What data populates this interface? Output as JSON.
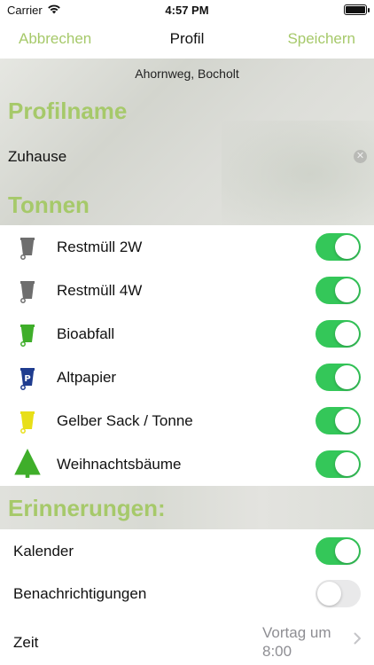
{
  "status": {
    "carrier": "Carrier",
    "time": "4:57 PM"
  },
  "nav": {
    "cancel": "Abbrechen",
    "title": "Profil",
    "save": "Speichern"
  },
  "location": "Ahornweg, Bocholt",
  "profile": {
    "section_title": "Profilname",
    "name_value": "Zuhause"
  },
  "bins": {
    "section_title": "Tonnen",
    "items": [
      {
        "label": "Restmüll 2W",
        "icon": "grey-bin-icon",
        "color": "#6e6e6e",
        "enabled": true
      },
      {
        "label": "Restmüll 4W",
        "icon": "grey-bin-icon",
        "color": "#6e6e6e",
        "enabled": true
      },
      {
        "label": "Bioabfall",
        "icon": "green-bin-icon",
        "color": "#3fae2a",
        "enabled": true
      },
      {
        "label": "Altpapier",
        "icon": "blue-paper-bin-icon",
        "color": "#1f3c8f",
        "enabled": true
      },
      {
        "label": "Gelber Sack / Tonne",
        "icon": "yellow-bin-icon",
        "color": "#e8df18",
        "enabled": true
      },
      {
        "label": "Weihnachtsbäume",
        "icon": "christmas-tree-icon",
        "color": "#3fae2a",
        "enabled": true
      }
    ]
  },
  "reminders": {
    "section_title": "Erinnerungen:",
    "calendar": {
      "label": "Kalender",
      "enabled": true
    },
    "notifications": {
      "label": "Benachrichtigungen",
      "enabled": false
    },
    "time": {
      "label": "Zeit",
      "value": "Vortag um 8:00"
    }
  },
  "colors": {
    "accent": "#a6c96a",
    "toggle_on": "#34c759"
  }
}
